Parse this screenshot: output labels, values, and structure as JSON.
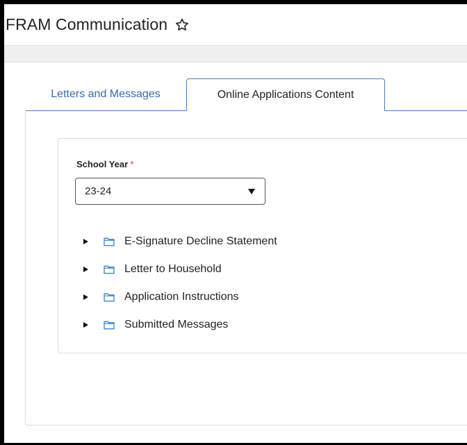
{
  "header": {
    "title": "FRAM Communication",
    "favorite_icon": "star-outline-icon"
  },
  "tabs": [
    {
      "label": "Letters and Messages",
      "active": false
    },
    {
      "label": "Online Applications Content",
      "active": true
    }
  ],
  "form": {
    "school_year_label": "School Year",
    "required_marker": "*",
    "school_year_value": "23-24"
  },
  "tree": [
    {
      "label": "E-Signature Decline Statement",
      "icon": "folder-icon",
      "expanded": false
    },
    {
      "label": "Letter to Household",
      "icon": "folder-icon",
      "expanded": false
    },
    {
      "label": "Application Instructions",
      "icon": "folder-icon",
      "expanded": false
    },
    {
      "label": "Submitted Messages",
      "icon": "folder-icon",
      "expanded": false
    }
  ],
  "colors": {
    "accent": "#3e82c4",
    "tab_text": "#3a6aa6",
    "required": "#c0392b"
  }
}
